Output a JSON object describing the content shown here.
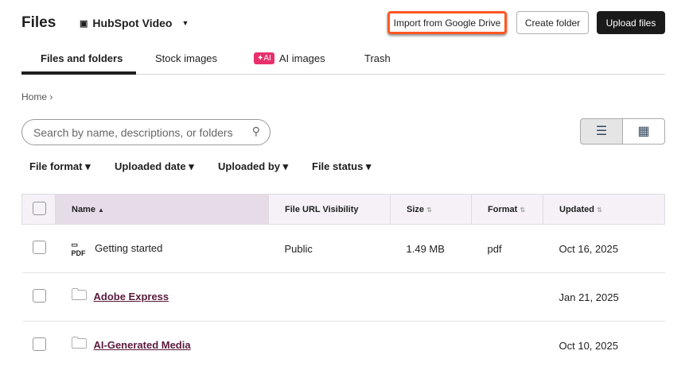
{
  "header": {
    "title": "Files",
    "account": "HubSpot Video",
    "import": "Import from Google Drive",
    "create": "Create folder",
    "upload": "Upload files"
  },
  "tabs": [
    "Files and folders",
    "Stock images",
    "AI images",
    "Trash"
  ],
  "ai_badge": "✦AI",
  "breadcrumb": "Home",
  "search": {
    "placeholder": "Search by name, descriptions, or folders"
  },
  "filters": [
    "File format",
    "Uploaded date",
    "Uploaded by",
    "File status"
  ],
  "table": {
    "columns": [
      "Name",
      "File URL Visibility",
      "Size",
      "Format",
      "Updated"
    ],
    "rows": [
      {
        "name": "Getting started",
        "visibility": "Public",
        "size": "1.49 MB",
        "format": "pdf",
        "updated": "Oct 16, 2025"
      },
      {
        "name": "Adobe Express",
        "updated": "Jan 21, 2025"
      },
      {
        "name": "AI-Generated Media",
        "updated": "Oct 10, 2025"
      }
    ]
  },
  "colors": {
    "highlight": "#ff5722",
    "primary": "#1f1f1f",
    "ai": "#e8306c"
  }
}
